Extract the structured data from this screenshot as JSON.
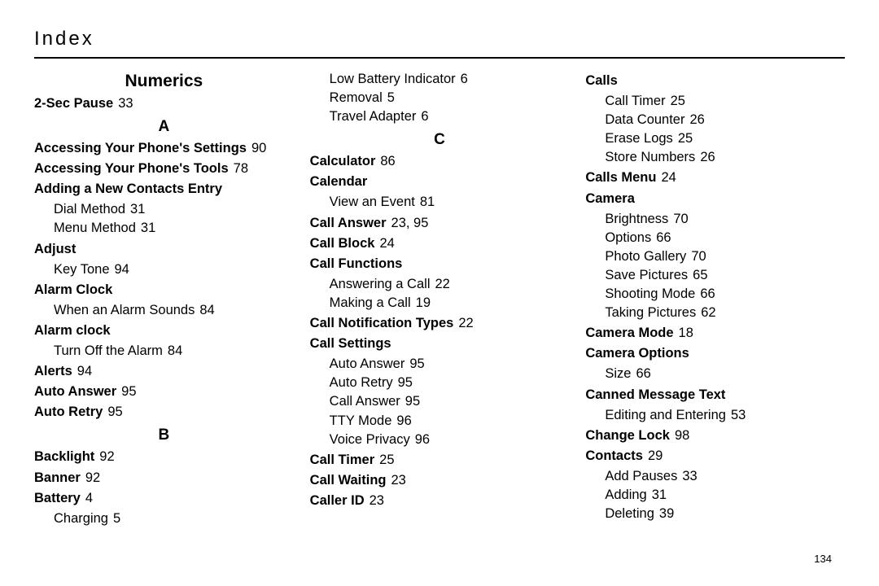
{
  "page_title": "Index",
  "page_number": "134",
  "columns": [
    {
      "items": [
        {
          "type": "bigheading",
          "text": "Numerics"
        },
        {
          "type": "bold",
          "label": "2-Sec Pause",
          "page": "33"
        },
        {
          "type": "letter",
          "text": "A"
        },
        {
          "type": "bold",
          "label": "Accessing Your Phone's Settings",
          "page": "90"
        },
        {
          "type": "bold",
          "label": "Accessing Your Phone's Tools",
          "page": "78"
        },
        {
          "type": "bold",
          "label": "Adding a New Contacts Entry"
        },
        {
          "type": "sub",
          "label": "Dial Method",
          "page": "31"
        },
        {
          "type": "sub",
          "label": "Menu Method",
          "page": "31"
        },
        {
          "type": "bold",
          "label": "Adjust"
        },
        {
          "type": "sub",
          "label": "Key Tone",
          "page": "94"
        },
        {
          "type": "bold",
          "label": "Alarm Clock"
        },
        {
          "type": "sub",
          "label": "When an Alarm Sounds",
          "page": "84"
        },
        {
          "type": "bold",
          "label": "Alarm clock"
        },
        {
          "type": "sub",
          "label": "Turn Off the Alarm",
          "page": "84"
        },
        {
          "type": "bold",
          "label": "Alerts",
          "page": "94"
        },
        {
          "type": "bold",
          "label": "Auto Answer",
          "page": "95"
        },
        {
          "type": "bold",
          "label": "Auto Retry",
          "page": "95"
        },
        {
          "type": "letter",
          "text": "B"
        },
        {
          "type": "bold",
          "label": "Backlight",
          "page": "92"
        },
        {
          "type": "bold",
          "label": "Banner",
          "page": "92"
        },
        {
          "type": "bold",
          "label": "Battery",
          "page": "4"
        },
        {
          "type": "sub",
          "label": "Charging",
          "page": "5"
        }
      ]
    },
    {
      "items": [
        {
          "type": "sub",
          "label": "Low Battery Indicator",
          "page": "6"
        },
        {
          "type": "sub",
          "label": "Removal",
          "page": "5"
        },
        {
          "type": "sub",
          "label": "Travel Adapter",
          "page": "6"
        },
        {
          "type": "letter",
          "text": "C"
        },
        {
          "type": "bold",
          "label": "Calculator",
          "page": "86"
        },
        {
          "type": "bold",
          "label": "Calendar"
        },
        {
          "type": "sub",
          "label": "View an Event",
          "page": "81"
        },
        {
          "type": "bold",
          "label": "Call Answer",
          "page": "23, 95"
        },
        {
          "type": "bold",
          "label": "Call Block",
          "page": "24"
        },
        {
          "type": "bold",
          "label": "Call Functions"
        },
        {
          "type": "sub",
          "label": "Answering a Call",
          "page": "22"
        },
        {
          "type": "sub",
          "label": "Making a Call",
          "page": "19"
        },
        {
          "type": "bold",
          "label": "Call Notification Types",
          "page": "22"
        },
        {
          "type": "bold",
          "label": "Call Settings"
        },
        {
          "type": "sub",
          "label": "Auto Answer",
          "page": "95"
        },
        {
          "type": "sub",
          "label": "Auto Retry",
          "page": "95"
        },
        {
          "type": "sub",
          "label": "Call Answer",
          "page": "95"
        },
        {
          "type": "sub",
          "label": "TTY Mode",
          "page": "96"
        },
        {
          "type": "sub",
          "label": "Voice Privacy",
          "page": "96"
        },
        {
          "type": "bold",
          "label": "Call Timer",
          "page": "25"
        },
        {
          "type": "bold",
          "label": "Call Waiting",
          "page": "23"
        },
        {
          "type": "bold",
          "label": "Caller ID",
          "page": "23"
        }
      ]
    },
    {
      "items": [
        {
          "type": "bold",
          "label": "Calls"
        },
        {
          "type": "sub",
          "label": "Call Timer",
          "page": "25"
        },
        {
          "type": "sub",
          "label": "Data Counter",
          "page": "26"
        },
        {
          "type": "sub",
          "label": "Erase Logs",
          "page": "25"
        },
        {
          "type": "sub",
          "label": "Store Numbers",
          "page": "26"
        },
        {
          "type": "bold",
          "label": "Calls Menu",
          "page": "24"
        },
        {
          "type": "bold",
          "label": "Camera"
        },
        {
          "type": "sub",
          "label": "Brightness",
          "page": "70"
        },
        {
          "type": "sub",
          "label": "Options",
          "page": "66"
        },
        {
          "type": "sub",
          "label": "Photo Gallery",
          "page": "70"
        },
        {
          "type": "sub",
          "label": "Save Pictures",
          "page": "65"
        },
        {
          "type": "sub",
          "label": "Shooting Mode",
          "page": "66"
        },
        {
          "type": "sub",
          "label": "Taking Pictures",
          "page": "62"
        },
        {
          "type": "bold",
          "label": "Camera Mode",
          "page": "18"
        },
        {
          "type": "bold",
          "label": "Camera Options"
        },
        {
          "type": "sub",
          "label": "Size",
          "page": "66"
        },
        {
          "type": "bold",
          "label": "Canned Message Text"
        },
        {
          "type": "sub",
          "label": "Editing and Entering",
          "page": "53"
        },
        {
          "type": "bold",
          "label": "Change Lock",
          "page": "98"
        },
        {
          "type": "bold",
          "label": "Contacts",
          "page": "29"
        },
        {
          "type": "sub",
          "label": "Add Pauses",
          "page": "33"
        },
        {
          "type": "sub",
          "label": "Adding",
          "page": "31"
        },
        {
          "type": "sub",
          "label": "Deleting",
          "page": "39"
        }
      ]
    }
  ]
}
